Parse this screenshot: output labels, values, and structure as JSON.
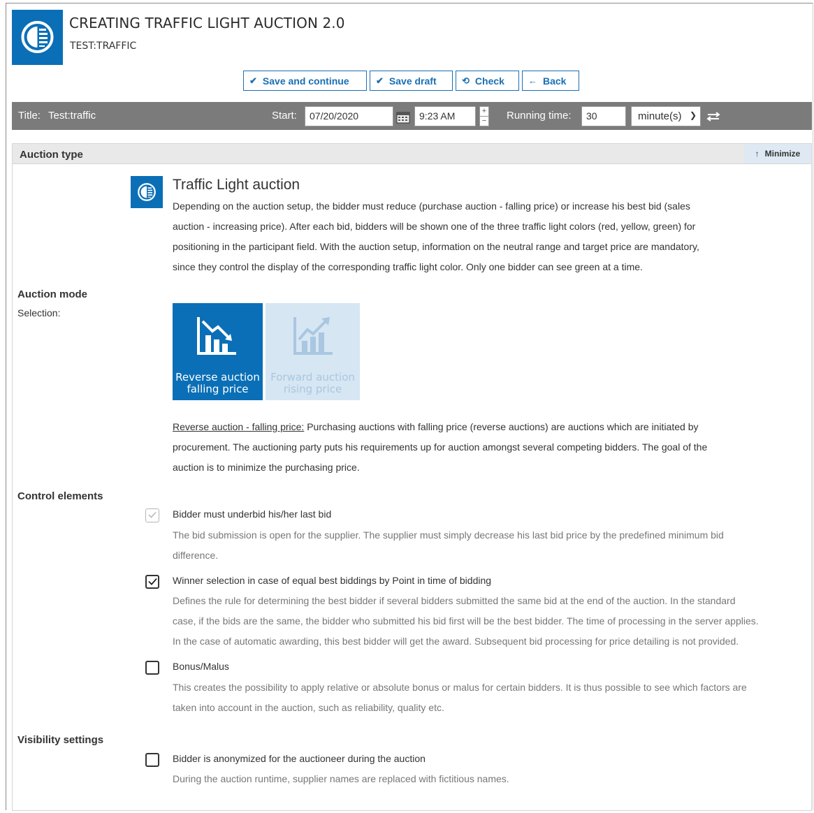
{
  "header": {
    "title": "CREATING TRAFFIC LIGHT AUCTION 2.0",
    "subtitle": "TEST:TRAFFIC",
    "logo_icon": "auction-logo-icon"
  },
  "toolbar": {
    "save_continue": "Save and continue",
    "save_draft": "Save draft",
    "check": "Check",
    "back": "Back"
  },
  "meta": {
    "title_label": "Title:",
    "title_value": "Test:traffic",
    "start_label": "Start:",
    "start_date": "07/20/2020",
    "start_time": "9:23 AM",
    "running_label": "Running time:",
    "running_value": "30",
    "unit": "minute(s)"
  },
  "panel": {
    "title": "Auction type",
    "minimize": "Minimize"
  },
  "auction_type": {
    "name": "Traffic Light auction",
    "description_lines": [
      "Depending on the auction setup, the bidder must reduce (purchase auction - falling price) or increase his best bid (sales",
      "auction - increasing price). After each bid, bidders will be shown one of the three traffic light colors (red, yellow, green) for",
      "positioning in the participant field. With the auction setup, information on the neutral range and target price are mandatory,",
      "since they control the display of the corresponding traffic light color. Only one bidder can see green at a time."
    ]
  },
  "auction_mode": {
    "label": "Auction mode",
    "selection_label": "Selection:",
    "reverse_line1": "Reverse auction",
    "reverse_line2": "falling price",
    "forward_line1": "Forward auction",
    "forward_line2": "rising price",
    "selected": "reverse",
    "info_link": "Reverse auction - falling price:",
    "info_lines": [
      " Purchasing auctions with falling price (reverse auctions) are auctions which are initiated by",
      "procurement. The auctioning party puts his requirements up for auction amongst several competing bidders. The goal of the",
      "auction is to minimize the purchasing price."
    ]
  },
  "control_elements": {
    "label": "Control elements",
    "options": [
      {
        "label": "Bidder must underbid his/her last bid",
        "checked": true,
        "disabled": true,
        "desc": [
          "The bid submission is open for the supplier. The supplier must simply decrease his last bid price by the predefined minimum bid",
          "difference."
        ]
      },
      {
        "label": "Winner selection in case of equal best biddings by Point in time of bidding",
        "checked": true,
        "disabled": false,
        "desc": [
          "Defines the rule for determining the best bidder if several bidders submitted the same bid at the end of the auction. In the standard",
          "case, if the bids are the same, the bidder who submitted his bid first will be the best bidder. The time of processing in the server applies.",
          "In the case of automatic awarding, this best bidder will get the award. Subsequent bid processing for price detailing is not provided."
        ]
      },
      {
        "label": "Bonus/Malus",
        "checked": false,
        "disabled": false,
        "desc": [
          "This creates the possibility to apply relative or absolute bonus or malus for certain bidders. It is thus possible to see which factors are",
          "taken into account in the auction, such as reliability, quality etc."
        ]
      }
    ]
  },
  "visibility": {
    "label": "Visibility settings",
    "options": [
      {
        "label": "Bidder is anonymized for the auctioneer during the auction",
        "checked": false,
        "desc": [
          "During the auction runtime, supplier names are replaced with fictitious names."
        ]
      }
    ]
  },
  "colors": {
    "brand_blue": "#0a6fb7",
    "toolbar_blue": "#1a6fb3",
    "metabar_grey": "#7b7b7b",
    "tile_inactive": "#d6e6f3"
  }
}
